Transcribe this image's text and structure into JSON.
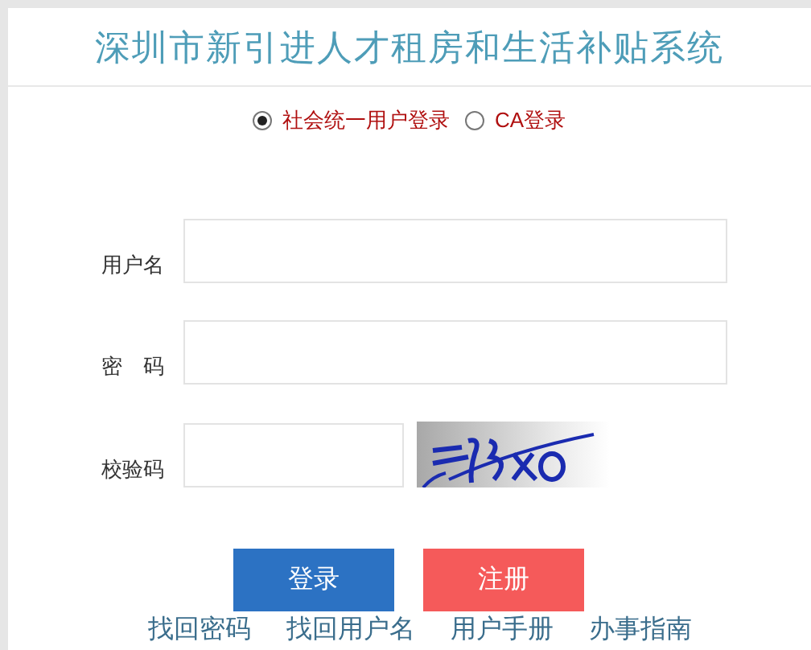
{
  "title": "深圳市新引进人才租房和生活补贴系统",
  "login_modes": [
    {
      "label": "社会统一用户登录",
      "selected": true
    },
    {
      "label": "CA登录",
      "selected": false
    }
  ],
  "fields": [
    {
      "label": "用户名",
      "kind": "text"
    },
    {
      "label": "密　码",
      "kind": "password"
    },
    {
      "label": "校验码",
      "kind": "captcha"
    }
  ],
  "buttons": [
    {
      "label": "登录",
      "kind": "primary"
    },
    {
      "label": "注册",
      "kind": "danger"
    }
  ],
  "links": [
    "找回密码",
    "找回用户名",
    "用户手册",
    "办事指南"
  ]
}
